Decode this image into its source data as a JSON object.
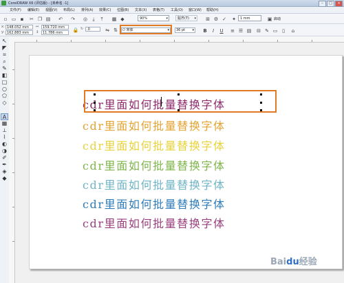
{
  "window": {
    "title": "CorelDRAW X6 (评估版) - [未命名 -1]",
    "buttons": {
      "minimize": "–",
      "maximize": "□",
      "close": "×"
    }
  },
  "menu": {
    "items": [
      "文件(F)",
      "编辑(E)",
      "视图(V)",
      "布局(L)",
      "排列(A)",
      "效果(C)",
      "位图(B)",
      "文本(X)",
      "表格(T)",
      "工具(O)",
      "窗口(W)",
      "帮助(H)"
    ]
  },
  "toolbar": {
    "zoom": "90%",
    "snap": "贴齐(T)",
    "nudge": "1 mm",
    "launch": "启动"
  },
  "properties": {
    "x": "148.052 mm",
    "y": "162.883 mm",
    "width": "159.720 mm",
    "height": "11.786 mm",
    "angle": ".0",
    "font_name": "宋体",
    "font_size": "36 pt"
  },
  "document": {
    "lines": [
      {
        "text": "cdr里面如何批量替换字体",
        "color": "#8e2a6b"
      },
      {
        "text": "cdr里面如何批量替换字体",
        "color": "#e3a332"
      },
      {
        "text": "cdr里面如何批量替换字体",
        "color": "#e8d23a"
      },
      {
        "text": "cdr里面如何批量替换字体",
        "color": "#7eb54a"
      },
      {
        "text": "cdr里面如何批量替换字体",
        "color": "#6fb4c6"
      },
      {
        "text": "cdr里面如何批量替换字体",
        "color": "#2e7bb8"
      },
      {
        "text": "cdr里面如何批量替换字体",
        "color": "#9a3e7e"
      }
    ]
  },
  "watermark": {
    "brand": "Bai",
    "paw": "du",
    "suffix": "经验"
  }
}
